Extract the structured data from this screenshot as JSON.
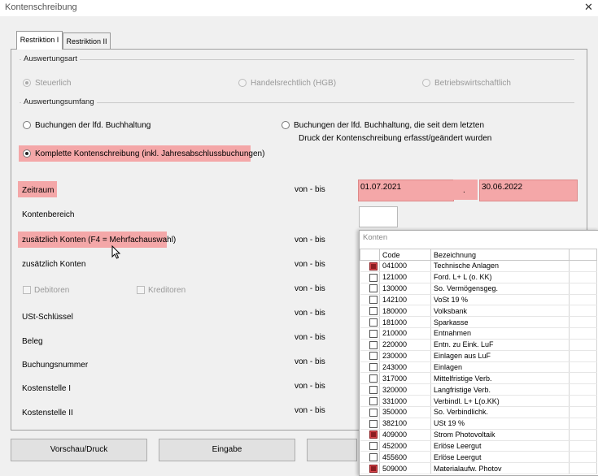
{
  "window": {
    "title": "Kontenschreibung"
  },
  "tabs": [
    {
      "label": "Restriktion I"
    },
    {
      "label": "Restriktion II"
    }
  ],
  "auswertungsart": {
    "label": "Auswertungsart",
    "options": [
      {
        "label": "Steuerlich"
      },
      {
        "label": "Handelsrechtlich (HGB)"
      },
      {
        "label": "Betriebswirtschaftlich"
      }
    ]
  },
  "auswertungsumfang": {
    "label": "Auswertungsumfang",
    "opt1": "Buchungen der lfd. Buchhaltung",
    "opt2_line1": "Buchungen der lfd. Buchhaltung, die seit dem letzten",
    "opt2_line2": "Druck der Kontenschreibung erfasst/geändert wurden",
    "opt3": "Komplette Kontenschreibung (inkl. Jahresabschlussbuchungen)"
  },
  "rows": {
    "zeitraum": "Zeitraum",
    "kontenbereich": "Kontenbereich",
    "zus_konten_f4": "zusätzlich Konten (F4 = Mehrfachauswahl)",
    "zus_konten": "zusätzlich Konten",
    "debitoren": "Debitoren",
    "kreditoren": "Kreditoren",
    "ust": "USt-Schlüssel",
    "beleg": "Beleg",
    "buchungsnummer": "Buchungsnummer",
    "kst1": "Kostenstelle I",
    "kst2": "Kostenstelle II"
  },
  "von_bis": "von - bis",
  "zeitraum": {
    "from": "01.07.2021",
    "separator": ".",
    "to": "30.06.2022"
  },
  "buttons": {
    "vorschau": "Vorschau/Druck",
    "eingabe": "Eingabe"
  },
  "konten_popup": {
    "title": "Konten",
    "col_code": "Code",
    "col_bezeichnung": "Bezeichnung",
    "items": [
      {
        "code": "041000",
        "name": "Technische Anlagen",
        "checked": true
      },
      {
        "code": "121000",
        "name": "Ford. L+ L (o. KK)",
        "checked": false
      },
      {
        "code": "130000",
        "name": "So. Vermögensgeg.",
        "checked": false
      },
      {
        "code": "142100",
        "name": "VoSt 19 %",
        "checked": false
      },
      {
        "code": "180000",
        "name": "Volksbank",
        "checked": false
      },
      {
        "code": "181000",
        "name": "Sparkasse",
        "checked": false
      },
      {
        "code": "210000",
        "name": "Entnahmen",
        "checked": false
      },
      {
        "code": "220000",
        "name": "Entn. zu Eink. LuF",
        "checked": false
      },
      {
        "code": "230000",
        "name": "Einlagen aus LuF",
        "checked": false
      },
      {
        "code": "243000",
        "name": "Einlagen",
        "checked": false
      },
      {
        "code": "317000",
        "name": "Mittelfristige Verb.",
        "checked": false
      },
      {
        "code": "320000",
        "name": "Langfristige Verb.",
        "checked": false
      },
      {
        "code": "331000",
        "name": "Verbindl. L+ L(o.KK)",
        "checked": false
      },
      {
        "code": "350000",
        "name": "So. Verbindlichk.",
        "checked": false
      },
      {
        "code": "382100",
        "name": "USt 19 %",
        "checked": false
      },
      {
        "code": "409000",
        "name": "Strom Photovoltaik",
        "checked": true
      },
      {
        "code": "452000",
        "name": "Erlöse Leergut",
        "checked": false
      },
      {
        "code": "455600",
        "name": "Erlöse Leergut",
        "checked": false
      },
      {
        "code": "509000",
        "name": "Materialaufw. Photov",
        "checked": true
      }
    ]
  }
}
